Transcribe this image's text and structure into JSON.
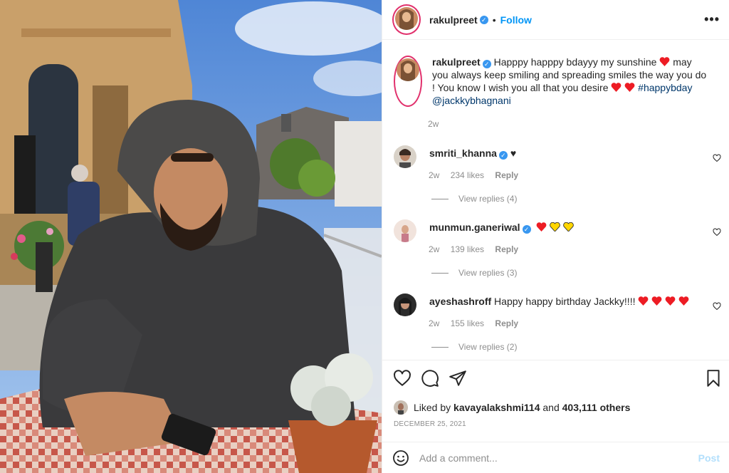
{
  "post": {
    "username": "rakulpreet",
    "follow_label": "Follow",
    "separator": "•",
    "more_label": "•••"
  },
  "caption": {
    "username": "rakulpreet",
    "text_1": "Happpy happpy bdayyy my sunshine",
    "text_2": "may you always keep smiling and spreading smiles the way you do ! You know I wish you all that you desire",
    "hashtag": "#happybday",
    "mention": "@jackkybhagnani",
    "time": "2w"
  },
  "comments": [
    {
      "username": "smriti_khanna",
      "text": "♥",
      "time": "2w",
      "likes": "234 likes",
      "reply_label": "Reply",
      "view_replies": "View replies (4)"
    },
    {
      "username": "munmun.ganeriwal",
      "text": "",
      "time": "2w",
      "likes": "139 likes",
      "reply_label": "Reply",
      "view_replies": "View replies (3)"
    },
    {
      "username": "ayeshashroff",
      "text": "Happy happy birthday Jackky!!!!",
      "time": "2w",
      "likes": "155 likes",
      "reply_label": "Reply",
      "view_replies": "View replies (2)"
    }
  ],
  "likes": {
    "prefix": "Liked by",
    "user": "kavayalakshmi114",
    "middle": "and",
    "others": "403,111 others"
  },
  "date": "DECEMBER 25, 2021",
  "add_comment": {
    "placeholder": "Add a comment...",
    "post_label": "Post"
  },
  "colors": {
    "accent": "#0095f6",
    "verified": "#3897f0",
    "heart_red": "#ed1c24",
    "heart_yellow": "#ffd600"
  },
  "icons": [
    "heart-icon",
    "comment-icon",
    "share-icon",
    "bookmark-icon",
    "emoji-icon",
    "verified-icon",
    "more-options-icon"
  ]
}
